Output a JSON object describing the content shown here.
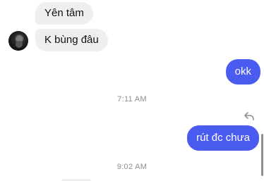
{
  "conversation": {
    "messages": [
      {
        "sender": "other",
        "text": "Yên tâm"
      },
      {
        "sender": "other",
        "text": "K bùng đâu"
      },
      {
        "sender": "me",
        "text": "okk"
      },
      {
        "type": "timestamp",
        "text": "7:11 AM"
      },
      {
        "sender": "me",
        "text": "rút đc chưa"
      },
      {
        "type": "timestamp",
        "text": "9:02 AM"
      }
    ]
  },
  "icons": {
    "avatar": "user-avatar",
    "reply": "reply-arrow-icon"
  },
  "colors": {
    "outgoing_bubble": "#4a5cf0",
    "incoming_bubble": "#efeff2",
    "timestamp_text": "#8e8e93"
  }
}
